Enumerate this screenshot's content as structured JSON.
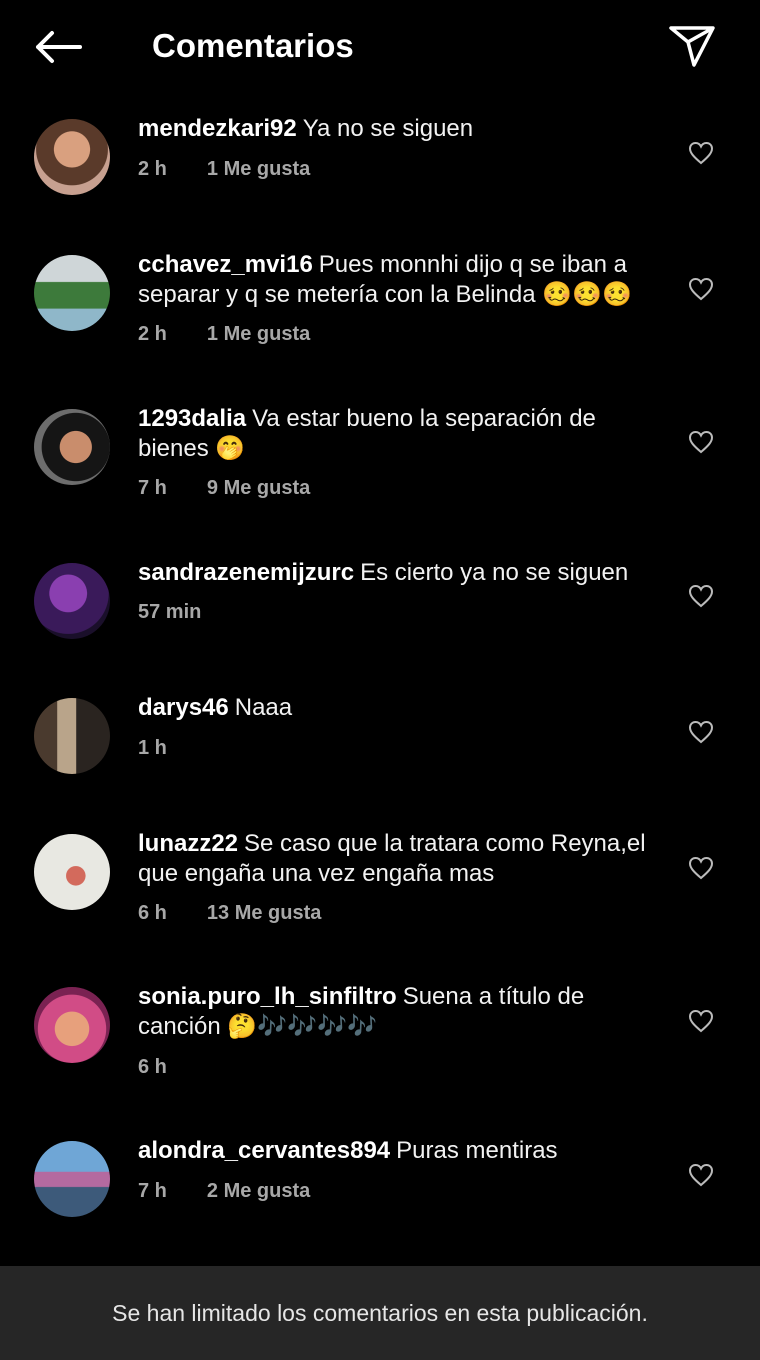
{
  "header": {
    "title": "Comentarios",
    "back_icon": "back-arrow-icon",
    "share_icon": "send-icon"
  },
  "colors": {
    "background": "#000000",
    "secondary_text": "#a8a8a8",
    "footer_bg": "#262626"
  },
  "comments": [
    {
      "user": "mendezkari92",
      "text": "Ya no se siguen",
      "time": "2 h",
      "likes": "1 Me gusta"
    },
    {
      "user": "cchavez_mvi16",
      "text": "Pues monnhi dijo q se iban a separar y q se metería con la Belinda",
      "emoji": "🥴🥴🥴",
      "time": "2 h",
      "likes": "1 Me gusta"
    },
    {
      "user": "1293dalia",
      "text": "Va estar bueno la separación de bienes",
      "emoji": "🤭",
      "time": "7 h",
      "likes": "9 Me gusta"
    },
    {
      "user": "sandrazenemijzurc",
      "text": "Es cierto ya no se siguen",
      "time": "57 min",
      "likes": ""
    },
    {
      "user": "darys46",
      "text": "Naaa",
      "time": "1 h",
      "likes": ""
    },
    {
      "user": "lunazz22",
      "text": "Se caso que la tratara como Reyna,el que engaña una vez engaña mas",
      "time": "6 h",
      "likes": "13 Me gusta"
    },
    {
      "user": "sonia.puro_lh_sinfiltro",
      "text": "Suena a título de canción",
      "emoji": "🤔🎶🎶🎶🎶",
      "time": "6 h",
      "likes": ""
    },
    {
      "user": "alondra_cervantes894",
      "text": "Puras mentiras",
      "time": "7 h",
      "likes": "2 Me gusta"
    }
  ],
  "footer": {
    "text": "Se han limitado los comentarios en esta publicación."
  }
}
